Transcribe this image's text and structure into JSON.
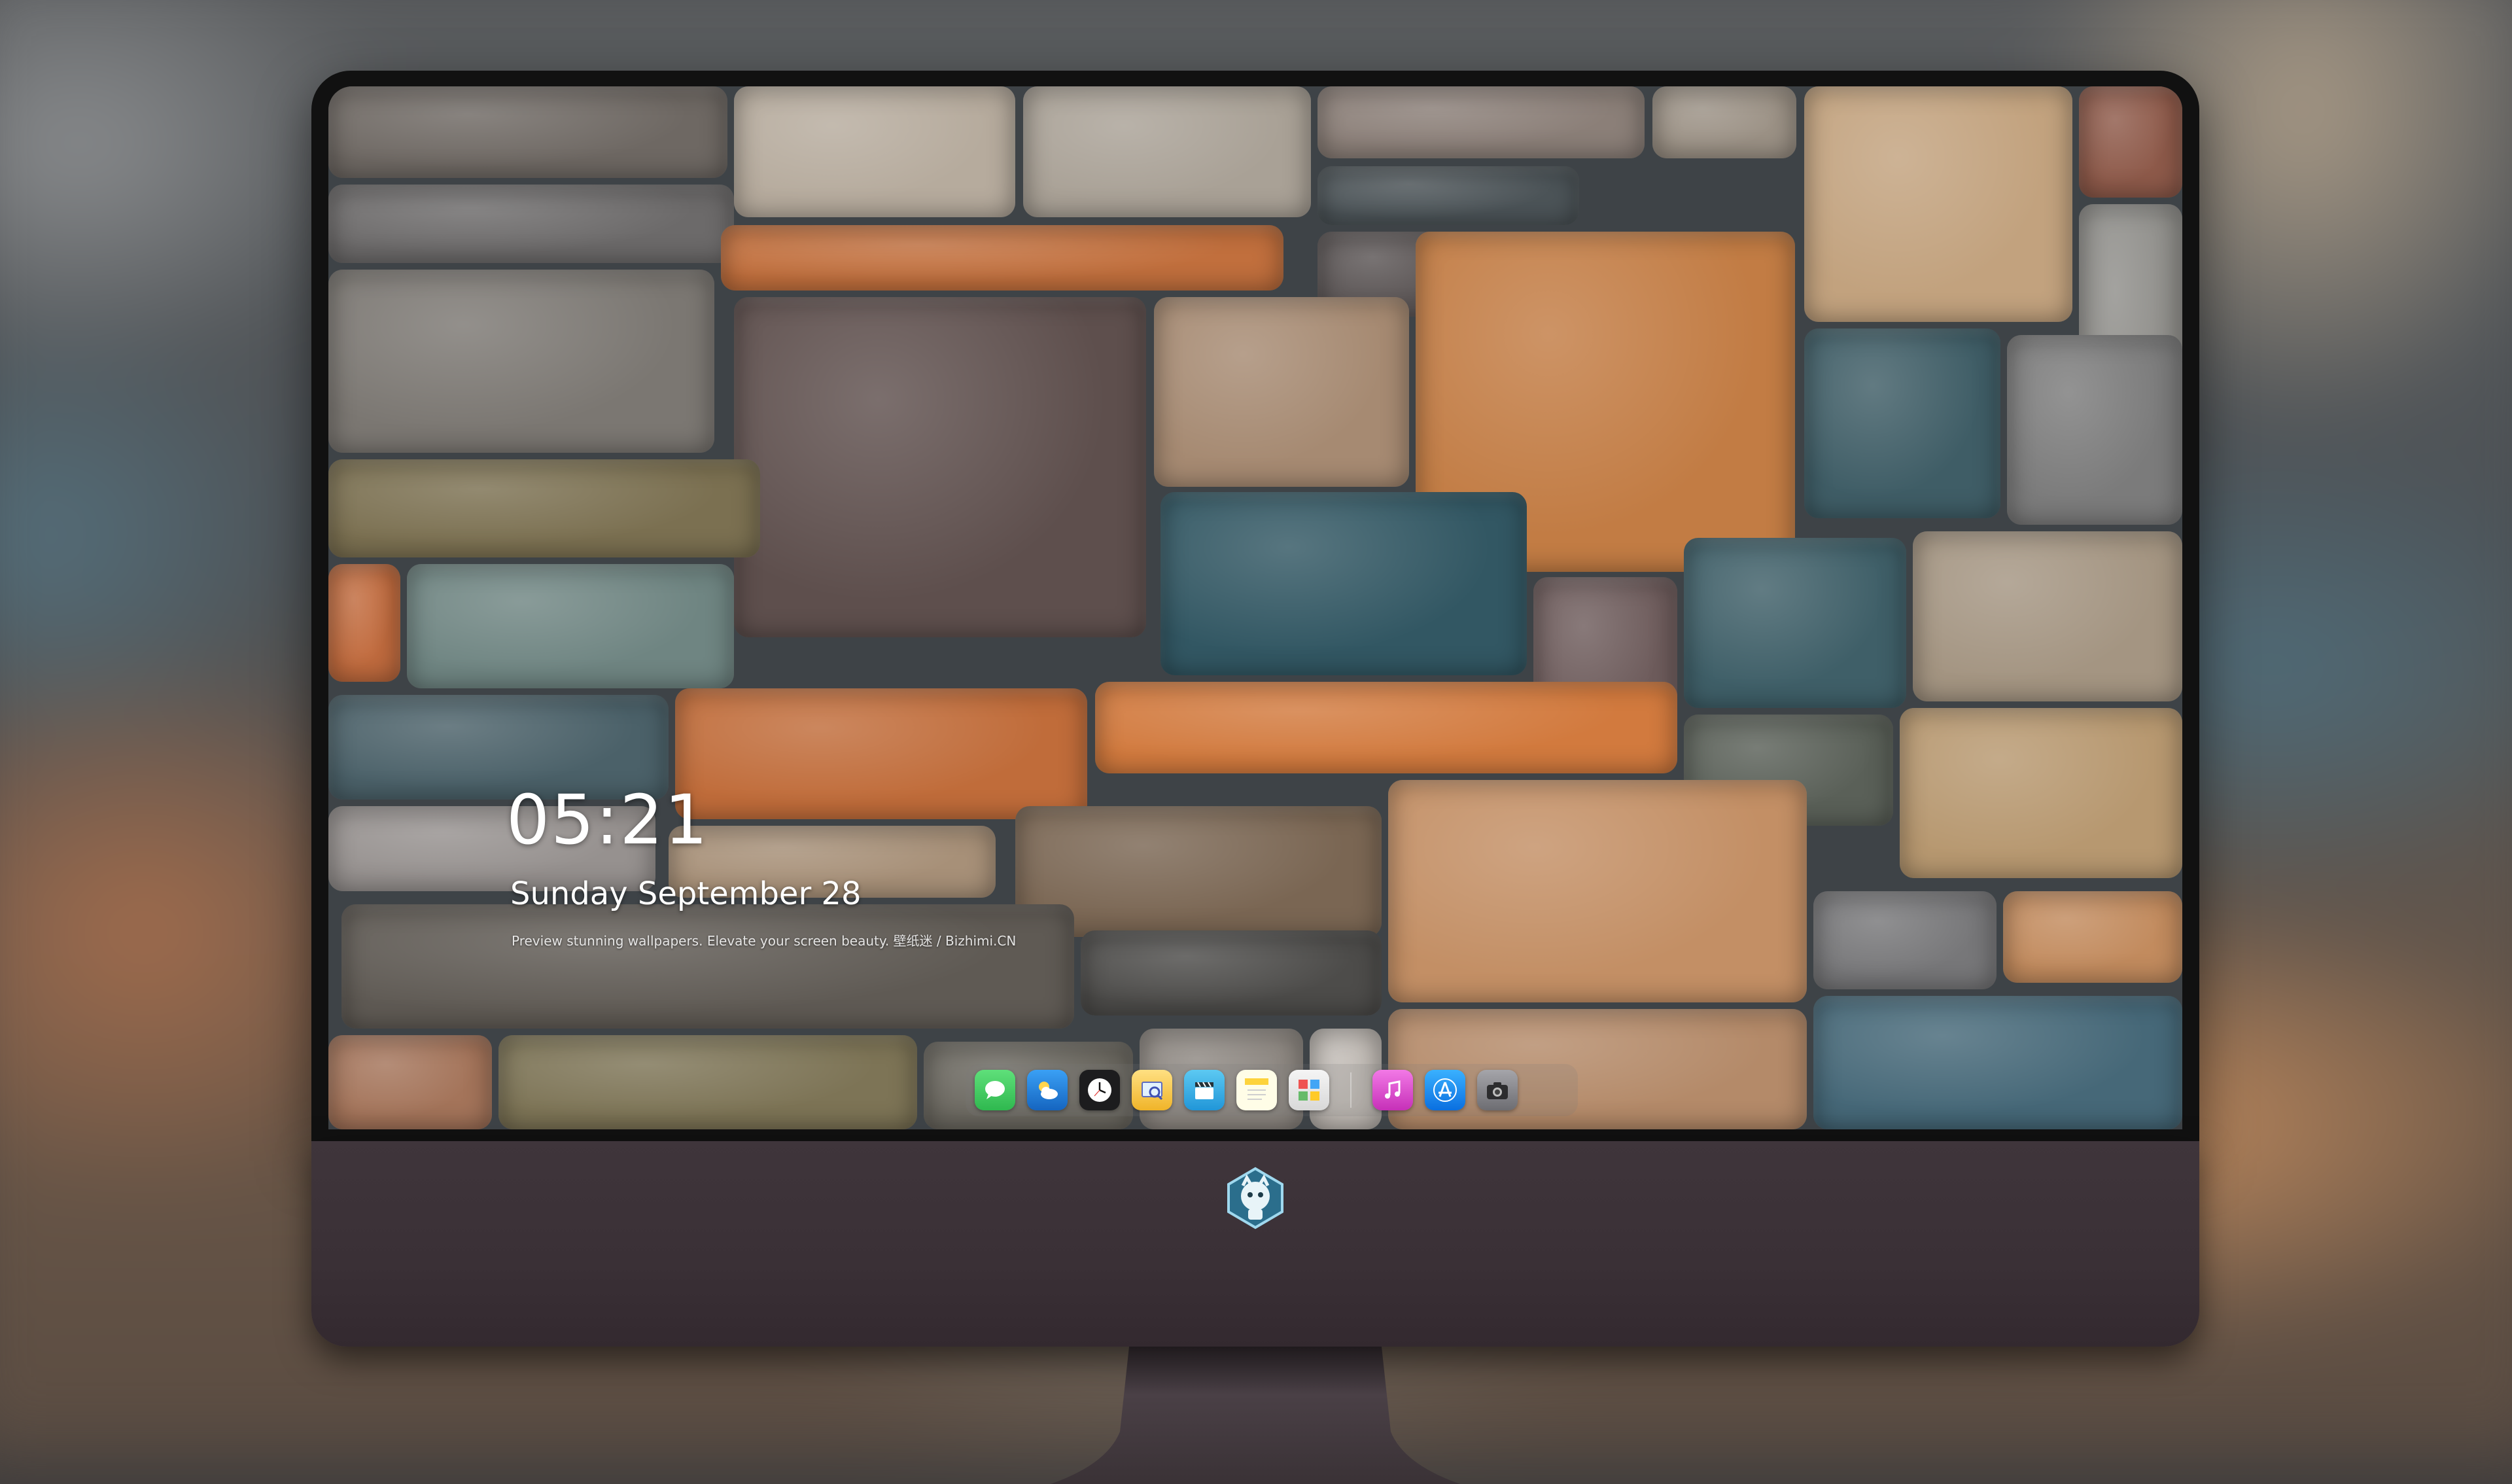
{
  "lock_screen": {
    "time": "05:21",
    "date": "Sunday September  28",
    "tagline": "Preview stunning wallpapers. Elevate your screen beauty. 壁纸迷 / Bizhimi.CN"
  },
  "dock": {
    "apps": [
      {
        "name": "Messages",
        "icon": "messages-icon",
        "color": "#34c759"
      },
      {
        "name": "Weather",
        "icon": "weather-icon",
        "color": "#1e88e5"
      },
      {
        "name": "Clock",
        "icon": "clock-icon",
        "color": "#ffffff"
      },
      {
        "name": "Preview",
        "icon": "preview-icon",
        "color": "#f5c33b"
      },
      {
        "name": "Clips",
        "icon": "clapperboard-icon",
        "color": "#37b6ea"
      },
      {
        "name": "Notes",
        "icon": "notes-icon",
        "color": "#fdd33c"
      },
      {
        "name": "Photo Booth",
        "icon": "photo-booth-icon",
        "color": "#e9e9e9"
      },
      {
        "name": "Music",
        "icon": "music-icon",
        "color": "#e94cd7"
      },
      {
        "name": "App Store",
        "icon": "app-store-icon",
        "color": "#1d8cf8"
      },
      {
        "name": "Camera",
        "icon": "camera-icon",
        "color": "#8e8e93"
      }
    ]
  },
  "colors": {
    "monitor_chin": "#3a3036",
    "bezel": "#111111",
    "stone_orange": "#c47a45",
    "stone_blue": "#3f5a66",
    "stone_grey": "#7d7770"
  }
}
